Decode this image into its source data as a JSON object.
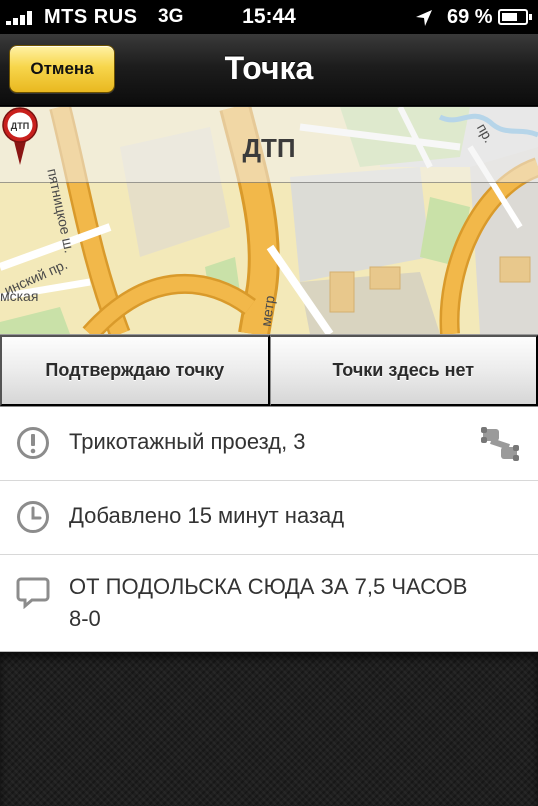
{
  "status_bar": {
    "carrier": "MTS RUS",
    "network": "3G",
    "time": "15:44",
    "battery": "69 %",
    "battery_level": 0.69,
    "signal_bars": 4
  },
  "nav": {
    "title": "Точка",
    "cancel_label": "Отмена"
  },
  "map": {
    "category_label": "ДТП",
    "pin_label": "ДТП",
    "street_labels": [
      "пятницкое ш.",
      "инский пр.",
      "мская",
      "пр.",
      "метр"
    ]
  },
  "actions": {
    "confirm_label": "Подтверждаю точку",
    "deny_label": "Точки здесь нет"
  },
  "details": {
    "address": "Трикотажный проезд, 3",
    "added": "Добавлено 15 минут назад",
    "comment": "ОТ ПОДОЛЬСКА СЮДА ЗА 7,5 ЧАСОВ 8-0"
  },
  "colors": {
    "accent_yellow": "#f7d64c",
    "map_background": "#f3e9b9",
    "highway": "#f2b84a",
    "pin_red": "#c8201d"
  }
}
